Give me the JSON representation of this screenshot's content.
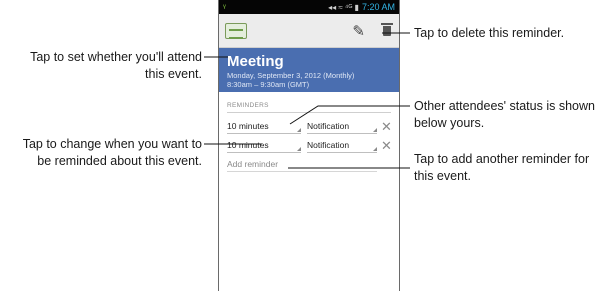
{
  "statusbar": {
    "signal": "ᵞ",
    "icons": "◂◂ ≈ ⁴ᴳ ▮",
    "time": "7:20 AM"
  },
  "event": {
    "title": "Meeting",
    "date_line": "Monday, September 3, 2012 (Monthly)",
    "time_line": "8:30am – 9:30am (GMT)"
  },
  "reminders": {
    "section_label": "REMINDERS",
    "rows": [
      {
        "time": "10 minutes",
        "method": "Notification"
      },
      {
        "time": "10 minutes",
        "method": "Notification"
      }
    ],
    "add_label": "Add reminder"
  },
  "callouts": {
    "attend": [
      "Tap to set whether you'll attend",
      "this event."
    ],
    "change": [
      "Tap to change when you want to",
      "be reminded about this event."
    ],
    "delete": [
      "Tap to delete this reminder."
    ],
    "attendees": [
      "Other attendees' status is shown",
      "below yours."
    ],
    "add": [
      "Tap to add another reminder for",
      "this event."
    ]
  },
  "icons": {
    "app": "calendar-icon",
    "edit": "edit-icon",
    "delete": "trash-icon",
    "remove": "close-icon"
  }
}
